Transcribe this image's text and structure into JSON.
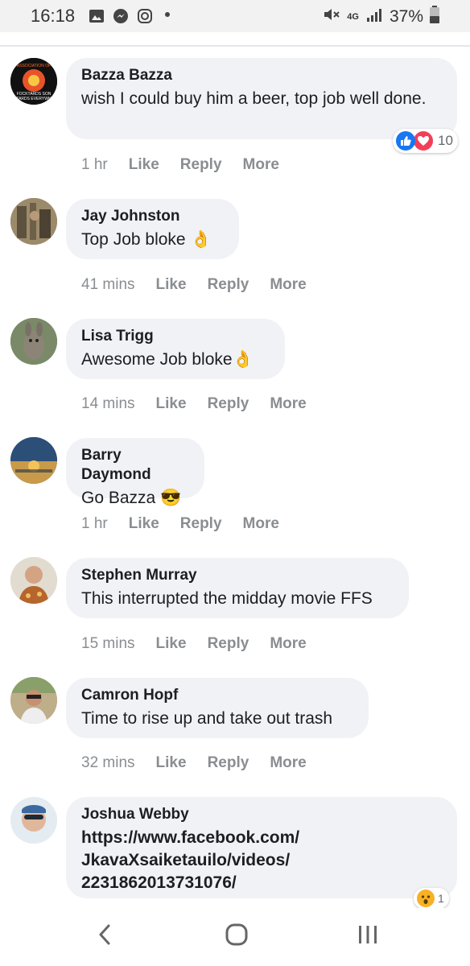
{
  "status": {
    "time": "16:18",
    "network": "4G",
    "battery": "37%"
  },
  "comments": [
    {
      "author": "Bazza Bazza",
      "text": "wish I could buy him a beer, top job well done.",
      "time": "1 hr",
      "reaction_count": "10"
    },
    {
      "author": "Jay Johnston",
      "text": "Top Job bloke",
      "emoji": "👌",
      "time": "41 mins"
    },
    {
      "author": "Lisa Trigg",
      "text": "Awesome Job bloke",
      "emoji": "👌",
      "time": "14 mins"
    },
    {
      "author": "Barry Daymond",
      "text": "Go Bazza",
      "emoji": "😎",
      "time": "1 hr"
    },
    {
      "author": "Stephen Murray",
      "text": "This interrupted the midday movie FFS",
      "time": "15 mins"
    },
    {
      "author": "Camron Hopf",
      "text": "Time to rise up and take out trash",
      "time": "32 mins"
    },
    {
      "author": "Joshua Webby",
      "link_lines": [
        "https://www.facebook.com/",
        "JkavaXsaiketauilo/videos/",
        "2231862013731076/"
      ],
      "reaction_count": "1"
    }
  ],
  "actions": {
    "like": "Like",
    "reply": "Reply",
    "more": "More"
  },
  "avatar0_text": {
    "top": "ASSOCIATION OF",
    "bottom1": "FOCKTARDS SON",
    "bottom2": "ETARDS EVERYWHE"
  },
  "colors": {
    "bubble": "#f0f2f5",
    "meta": "#8a8d91",
    "like_blue": "#1877f2",
    "love_red": "#f33e58"
  }
}
